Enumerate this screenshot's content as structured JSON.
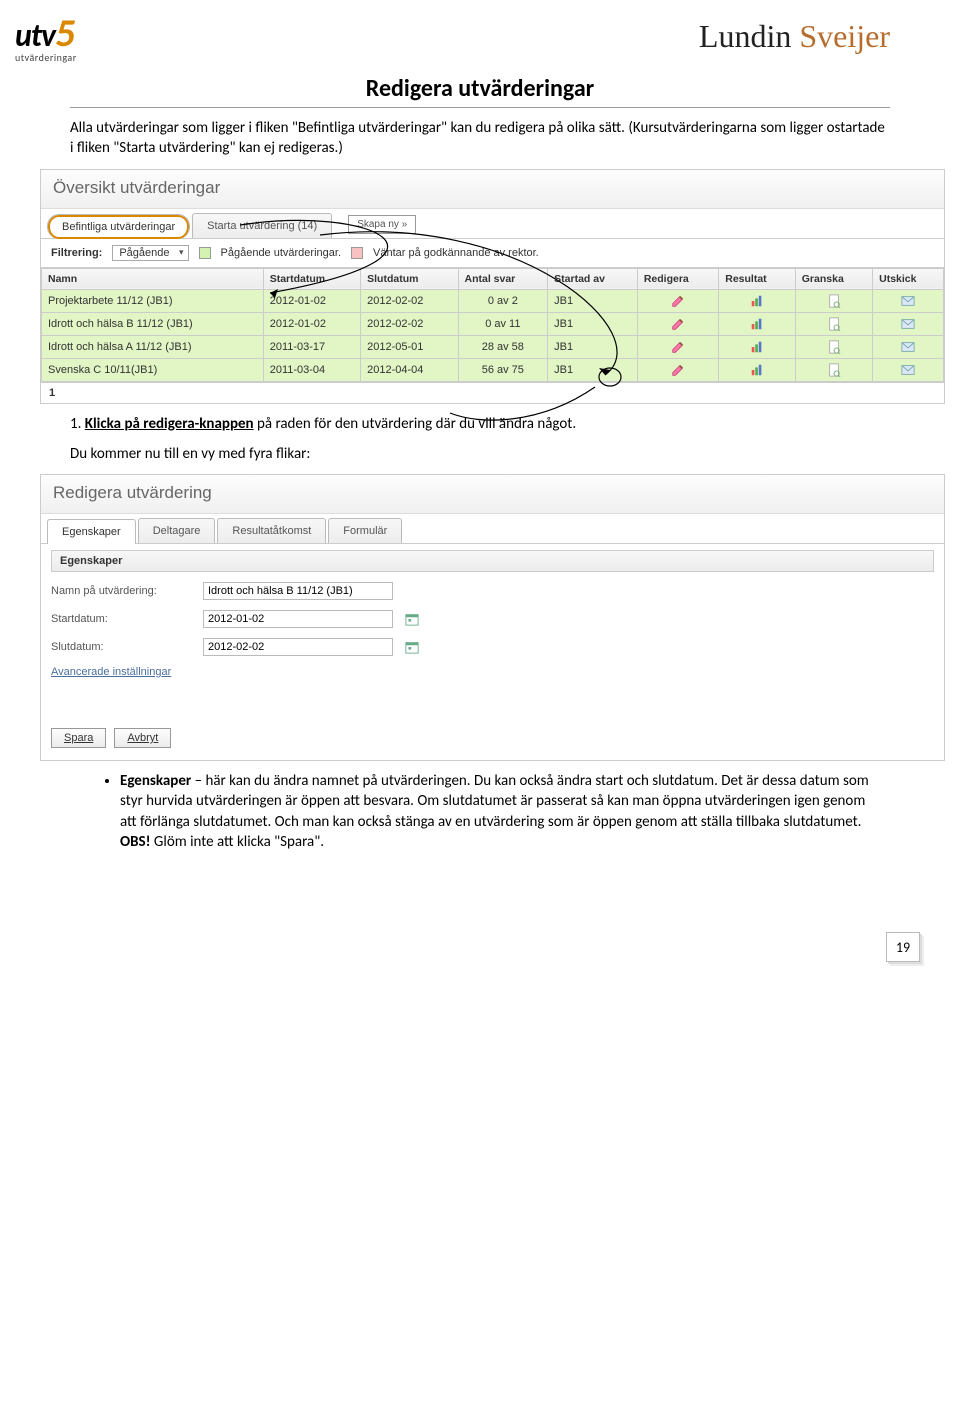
{
  "logo": {
    "text": "utv",
    "five": "5",
    "sub": "utvärderingar"
  },
  "brand": {
    "a": "Lundin ",
    "b": "Sveijer"
  },
  "title": "Redigera utvärderingar",
  "intro": "Alla utvärderingar som ligger i fliken \"Befintliga utvärderingar\" kan du redigera på olika sätt. (Kursutvärderingarna som ligger ostartade i fliken \"Starta utvärdering\" kan ej redigeras.)",
  "step1_a": "1. ",
  "step1_b": "Klicka på redigera-knappen",
  "step1_c": " på raden för den utvärdering där du vill ändra något.",
  "step2": "Du kommer nu till en vy med fyra flikar:",
  "panel1": {
    "heading": "Översikt utvärderingar",
    "tabs": {
      "t1": "Befintliga utvärderingar",
      "t2": "Starta utvärdering (14)",
      "btn": "Skapa ny »"
    },
    "filter": {
      "label": "Filtrering:",
      "value": "Pågående",
      "legend1": "Pågående utvärderingar.",
      "legend2": "Väntar på godkännande av rektor."
    },
    "cols": {
      "c1": "Namn",
      "c2": "Startdatum",
      "c3": "Slutdatum",
      "c4": "Antal svar",
      "c5": "Startad av",
      "c6": "Redigera",
      "c7": "Resultat",
      "c8": "Granska",
      "c9": "Utskick"
    },
    "rows": [
      {
        "name": "Projektarbete 11/12 (JB1)",
        "start": "2012-01-02",
        "end": "2012-02-02",
        "count": "0 av 2",
        "by": "JB1"
      },
      {
        "name": "Idrott och hälsa B 11/12 (JB1)",
        "start": "2012-01-02",
        "end": "2012-02-02",
        "count": "0 av 11",
        "by": "JB1"
      },
      {
        "name": "Idrott och hälsa A 11/12 (JB1)",
        "start": "2011-03-17",
        "end": "2012-05-01",
        "count": "28 av 58",
        "by": "JB1"
      },
      {
        "name": "Svenska C 10/11(JB1)",
        "start": "2011-03-04",
        "end": "2012-04-04",
        "count": "56 av 75",
        "by": "JB1"
      }
    ],
    "page": "1"
  },
  "panel2": {
    "heading": "Redigera utvärdering",
    "tabs": {
      "t1": "Egenskaper",
      "t2": "Deltagare",
      "t3": "Resultatåtkomst",
      "t4": "Formulär"
    },
    "section": "Egenskaper",
    "labels": {
      "name": "Namn på utvärdering:",
      "start": "Startdatum:",
      "end": "Slutdatum:",
      "adv": "Avancerade inställningar"
    },
    "values": {
      "name": "Idrott och hälsa B 11/12 (JB1)",
      "start": "2012-01-02",
      "end": "2012-02-02"
    },
    "buttons": {
      "save": "Spara",
      "cancel": "Avbryt"
    }
  },
  "bullet": {
    "bold": "Egenskaper",
    "rest": " – här kan du ändra namnet på utvärderingen. Du kan också ändra start och slutdatum. Det är dessa datum som styr hurvida utvärderingen är öppen att besvara. Om slutdatumet är passerat så kan man öppna utvärderingen igen genom att förlänga slutdatumet. Och man kan också stänga av en utvärdering som är öppen genom att ställa tillbaka slutdatumet. ",
    "obs": "OBS!",
    "obs_text": " Glöm inte att klicka \"Spara\"."
  },
  "pagenum": "19"
}
